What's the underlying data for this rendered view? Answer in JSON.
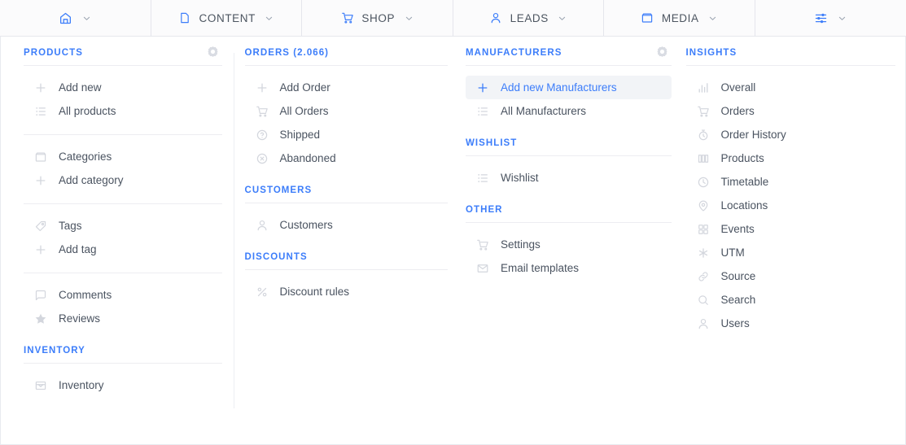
{
  "topnav": {
    "items": [
      {
        "icon": "home-icon",
        "label": "",
        "caret": true
      },
      {
        "icon": "file-icon",
        "label": "CONTENT",
        "caret": true
      },
      {
        "icon": "cart-icon",
        "label": "SHOP",
        "caret": true
      },
      {
        "icon": "user-icon",
        "label": "LEADS",
        "caret": true
      },
      {
        "icon": "folder-icon",
        "label": "MEDIA",
        "caret": true
      },
      {
        "icon": "sliders-icon",
        "label": "",
        "caret": true
      }
    ]
  },
  "colors": {
    "accent": "#3c7dfa",
    "text": "#4a5360",
    "icon_muted": "#d3d6dd",
    "active_bg": "#f2f4f7",
    "divider": "#ededf1",
    "header_bg": "#fbfbfc"
  },
  "columns": [
    {
      "name": "products-column",
      "sections": [
        {
          "title": "PRODUCTS",
          "gear": true,
          "groups": [
            {
              "divided": true,
              "items": [
                {
                  "icon": "plus-icon",
                  "label": "Add new",
                  "active": false
                },
                {
                  "icon": "list-icon",
                  "label": "All products",
                  "active": false
                }
              ]
            },
            {
              "divided": true,
              "items": [
                {
                  "icon": "folder-icon",
                  "label": "Categories",
                  "active": false
                },
                {
                  "icon": "plus-icon",
                  "label": "Add category",
                  "active": false
                }
              ]
            },
            {
              "divided": true,
              "items": [
                {
                  "icon": "tag-icon",
                  "label": "Tags",
                  "active": false
                },
                {
                  "icon": "plus-icon",
                  "label": "Add tag",
                  "active": false
                }
              ]
            },
            {
              "divided": false,
              "items": [
                {
                  "icon": "comment-icon",
                  "label": "Comments",
                  "active": false
                },
                {
                  "icon": "star-icon",
                  "label": "Reviews",
                  "active": false
                }
              ]
            }
          ]
        },
        {
          "title": "INVENTORY",
          "gear": false,
          "groups": [
            {
              "divided": false,
              "items": [
                {
                  "icon": "inventory-icon",
                  "label": "Inventory",
                  "active": false
                }
              ]
            }
          ]
        }
      ]
    },
    {
      "name": "orders-column",
      "sections": [
        {
          "title": "ORDERS (2.066)",
          "gear": false,
          "groups": [
            {
              "divided": false,
              "items": [
                {
                  "icon": "plus-icon",
                  "label": "Add Order",
                  "active": false
                },
                {
                  "icon": "cart-icon",
                  "label": "All Orders",
                  "active": false
                },
                {
                  "icon": "question-circle-icon",
                  "label": "Shipped",
                  "active": false
                },
                {
                  "icon": "x-circle-icon",
                  "label": "Abandoned",
                  "active": false
                }
              ]
            }
          ]
        },
        {
          "title": "CUSTOMERS",
          "gear": false,
          "groups": [
            {
              "divided": false,
              "items": [
                {
                  "icon": "user-icon",
                  "label": "Customers",
                  "active": false
                }
              ]
            }
          ]
        },
        {
          "title": "DISCOUNTS",
          "gear": false,
          "groups": [
            {
              "divided": false,
              "items": [
                {
                  "icon": "percent-icon",
                  "label": "Discount rules",
                  "active": false
                }
              ]
            }
          ]
        }
      ]
    },
    {
      "name": "manufacturers-column",
      "sections": [
        {
          "title": "MANUFACTURERS",
          "gear": true,
          "groups": [
            {
              "divided": false,
              "items": [
                {
                  "icon": "plus-icon",
                  "label": "Add new Manufacturers",
                  "active": true
                },
                {
                  "icon": "list-icon",
                  "label": "All Manufacturers",
                  "active": false
                }
              ]
            }
          ]
        },
        {
          "title": "WISHLIST",
          "gear": false,
          "groups": [
            {
              "divided": false,
              "items": [
                {
                  "icon": "list-icon",
                  "label": "Wishlist",
                  "active": false
                }
              ]
            }
          ]
        },
        {
          "title": "OTHER",
          "gear": false,
          "groups": [
            {
              "divided": false,
              "items": [
                {
                  "icon": "cart-icon",
                  "label": "Settings",
                  "active": false
                },
                {
                  "icon": "mail-icon",
                  "label": "Email templates",
                  "active": false
                }
              ]
            }
          ]
        }
      ]
    },
    {
      "name": "insights-column",
      "sections": [
        {
          "title": "INSIGHTS",
          "gear": false,
          "groups": [
            {
              "divided": false,
              "items": [
                {
                  "icon": "bar-chart-icon",
                  "label": "Overall",
                  "active": false
                },
                {
                  "icon": "cart-icon",
                  "label": "Orders",
                  "active": false
                },
                {
                  "icon": "stopwatch-icon",
                  "label": "Order History",
                  "active": false
                },
                {
                  "icon": "columns-icon",
                  "label": "Products",
                  "active": false
                },
                {
                  "icon": "clock-icon",
                  "label": "Timetable",
                  "active": false
                },
                {
                  "icon": "pin-icon",
                  "label": "Locations",
                  "active": false
                },
                {
                  "icon": "grid-icon",
                  "label": "Events",
                  "active": false
                },
                {
                  "icon": "asterisk-icon",
                  "label": "UTM",
                  "active": false
                },
                {
                  "icon": "link-icon",
                  "label": "Source",
                  "active": false
                },
                {
                  "icon": "search-icon",
                  "label": "Search",
                  "active": false
                },
                {
                  "icon": "user-icon",
                  "label": "Users",
                  "active": false
                }
              ]
            }
          ]
        }
      ]
    }
  ]
}
